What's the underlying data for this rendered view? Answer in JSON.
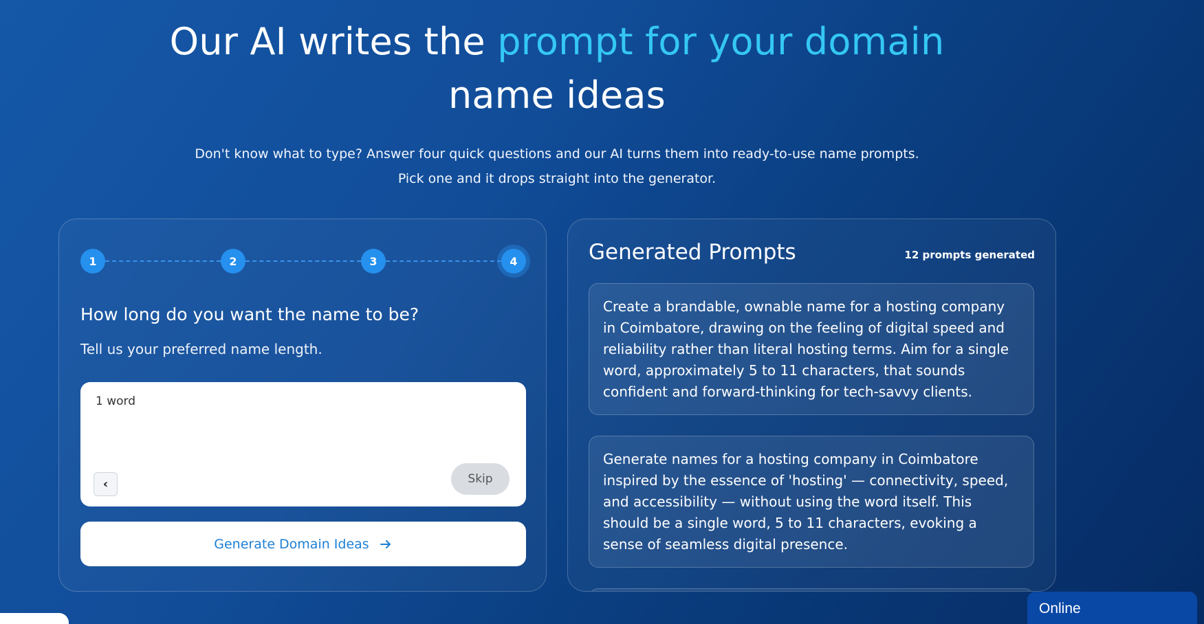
{
  "hero": {
    "title_part1": "Our AI writes the ",
    "title_accent": "prompt for your domain",
    "title_part2": "name ideas",
    "subtitle_line1": "Don't know what to type? Answer four quick questions and our AI turns them into ready-to-use name prompts.",
    "subtitle_line2": "Pick one and it drops straight into the generator."
  },
  "wizard": {
    "steps": [
      "1",
      "2",
      "3",
      "4"
    ],
    "active_step": 4,
    "question": "How long do you want the name to be?",
    "hint": "Tell us your preferred name length.",
    "answer_value": "1 word",
    "back_label": "‹",
    "skip_label": "Skip",
    "generate_label": "Generate Domain Ideas"
  },
  "prompts_panel": {
    "title": "Generated Prompts",
    "count_label": "12 prompts generated",
    "prompts": [
      "Create a brandable, ownable name for a hosting company in Coimbatore, drawing on the feeling of digital speed and reliability rather than literal hosting terms. Aim for a single word, approximately 5 to 11 characters, that sounds confident and forward-thinking for tech-savvy clients.",
      "Generate names for a hosting company in Coimbatore inspired by the essence of 'hosting' — connectivity, speed, and accessibility — without using the word itself. This should be a single word, 5 to 11 characters, evoking a sense of seamless digital presence."
    ]
  },
  "chat_widget": {
    "status_label": "Online"
  },
  "colors": {
    "accent": "#35c7f4",
    "step_blue": "#2590ee",
    "button_text": "#1c7fd4"
  }
}
